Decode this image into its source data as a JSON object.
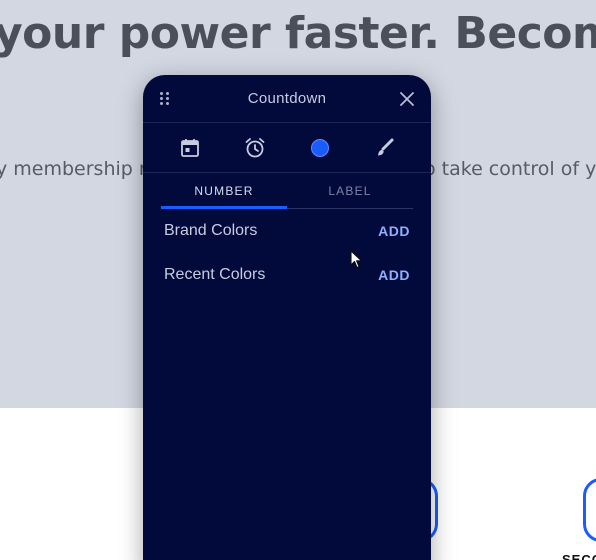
{
  "background": {
    "headline": "your power faster. Becom",
    "subtext_left": "y membership n",
    "subtext_right": "o take control of yo",
    "seconds_label": "SECO"
  },
  "panel": {
    "title": "Countdown",
    "tabs": [
      {
        "label": "NUMBER",
        "active": true
      },
      {
        "label": "LABEL",
        "active": false
      }
    ],
    "rows": [
      {
        "label": "Brand Colors",
        "action": "ADD"
      },
      {
        "label": "Recent Colors",
        "action": "ADD"
      }
    ],
    "toolbar_icons": [
      "calendar-icon",
      "alarm-clock-icon",
      "color-circle-icon",
      "paint-brush-icon"
    ]
  },
  "colors": {
    "panel_bg": "#020a3b",
    "accent": "#1a5cff",
    "add_link": "#8fb0ff",
    "page_bg_top": "#d3d7e2"
  }
}
